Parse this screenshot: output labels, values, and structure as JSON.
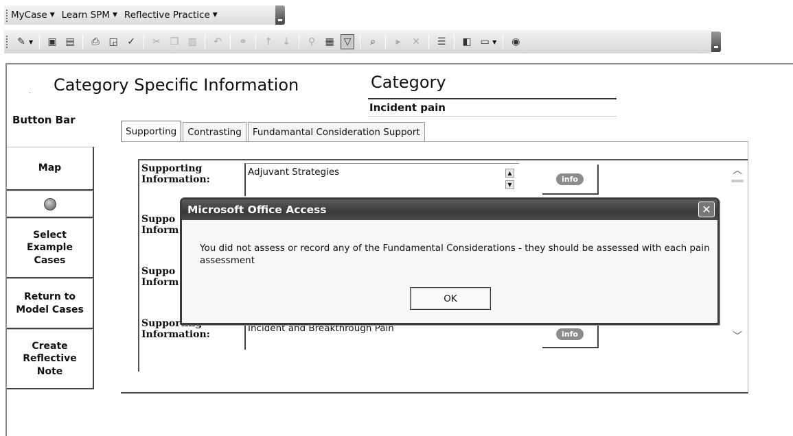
{
  "menu": {
    "items": [
      "MyCase",
      "Learn SPM",
      "Reflective Practice"
    ]
  },
  "toolbar": {
    "icons": [
      "design-view-icon",
      "save-icon",
      "file-search-icon",
      "print-icon",
      "print-preview-icon",
      "spelling-icon",
      "cut-icon",
      "copy-icon",
      "paste-icon",
      "undo-icon",
      "hyperlink-icon",
      "sort-ascending-icon",
      "sort-descending-icon",
      "filter-by-selection-icon",
      "filter-by-form-icon",
      "apply-filter-icon",
      "find-icon",
      "new-record-icon",
      "delete-record-icon",
      "properties-icon",
      "database-window-icon",
      "new-object-icon",
      "help-icon"
    ]
  },
  "form": {
    "title": "Category Specific Information",
    "category_label": "Category",
    "category_value": "Incident pain"
  },
  "button_bar": {
    "title": "Button Bar",
    "buttons": [
      "Map",
      "",
      "Select Example Cases",
      "Return to Model Cases",
      "Create Reflective Note"
    ]
  },
  "tabs": [
    "Supporting",
    "Contrasting",
    "Fundamantal Consideration Support"
  ],
  "rows": [
    {
      "label": "Supporting Information:",
      "value": "Adjuvant Strategies",
      "info": "info"
    },
    {
      "label": "Suppo Inform",
      "value": "",
      "info": ""
    },
    {
      "label": "Suppo Inform",
      "value": "",
      "info": ""
    },
    {
      "label": "Supporting Information:",
      "value": "Incident and Breakthrough Pain",
      "info": "info"
    }
  ],
  "dialog": {
    "title": "Microsoft Office Access",
    "message": "You did not assess or record any of the Fundamental Considerations - they should be assessed with each pain assessment",
    "ok_label": "OK",
    "close_glyph": "✕"
  }
}
